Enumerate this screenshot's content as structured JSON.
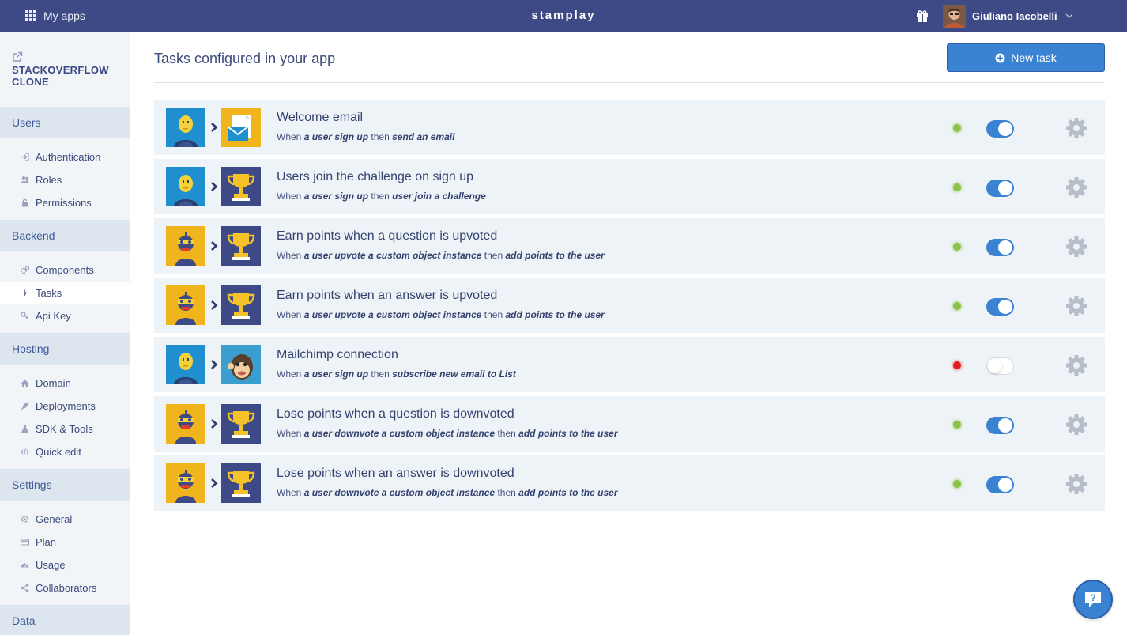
{
  "topbar": {
    "my_apps_label": "My apps",
    "brand": "stamplay",
    "user_name": "Giuliano Iacobelli"
  },
  "sidebar": {
    "app_name": "STACKOVERFLOW CLONE",
    "sections": [
      {
        "title": "Users",
        "items": [
          {
            "label": "Authentication",
            "icon": "sign-in-icon"
          },
          {
            "label": "Roles",
            "icon": "users-icon"
          },
          {
            "label": "Permissions",
            "icon": "lock-icon"
          }
        ]
      },
      {
        "title": "Backend",
        "items": [
          {
            "label": "Components",
            "icon": "cogs-icon"
          },
          {
            "label": "Tasks",
            "icon": "bolt-icon",
            "active": true
          },
          {
            "label": "Api Key",
            "icon": "key-icon"
          }
        ]
      },
      {
        "title": "Hosting",
        "items": [
          {
            "label": "Domain",
            "icon": "home-icon"
          },
          {
            "label": "Deployments",
            "icon": "rocket-icon"
          },
          {
            "label": "SDK & Tools",
            "icon": "flask-icon"
          },
          {
            "label": "Quick edit",
            "icon": "code-icon"
          }
        ]
      },
      {
        "title": "Settings",
        "items": [
          {
            "label": "General",
            "icon": "gear-icon"
          },
          {
            "label": "Plan",
            "icon": "credit-card-icon"
          },
          {
            "label": "Usage",
            "icon": "dashboard-icon"
          },
          {
            "label": "Collaborators",
            "icon": "share-icon"
          }
        ]
      },
      {
        "title": "Data",
        "items": []
      }
    ]
  },
  "main": {
    "title": "Tasks configured in your app",
    "new_task_label": "New task",
    "tasks": [
      {
        "title": "Welcome email",
        "when": "When",
        "trigger": "a user sign up",
        "then": "then",
        "action": "send an email",
        "trigger_icon": "user-icon",
        "action_icon": "email-icon",
        "enabled": true,
        "status": "active"
      },
      {
        "title": "Users join the challenge on sign up",
        "when": "When",
        "trigger": "a user sign up",
        "then": "then",
        "action": "user join a challenge",
        "trigger_icon": "user-icon",
        "action_icon": "trophy-icon",
        "enabled": true,
        "status": "active"
      },
      {
        "title": "Earn points when a question is upvoted",
        "when": "When",
        "trigger": "a user upvote a custom object instance",
        "then": "then",
        "action": "add points to the user",
        "trigger_icon": "robot-icon",
        "action_icon": "trophy-icon",
        "enabled": true,
        "status": "active"
      },
      {
        "title": "Earn points when an answer is upvoted",
        "when": "When",
        "trigger": "a user upvote a custom object instance",
        "then": "then",
        "action": "add points to the user",
        "trigger_icon": "robot-icon",
        "action_icon": "trophy-icon",
        "enabled": true,
        "status": "active"
      },
      {
        "title": "Mailchimp connection",
        "when": "When",
        "trigger": "a user sign up",
        "then": "then",
        "action": "subscribe new email to List",
        "trigger_icon": "user-icon",
        "action_icon": "mailchimp-icon",
        "enabled": false,
        "status": "error"
      },
      {
        "title": "Lose points when a question is downvoted",
        "when": "When",
        "trigger": "a user downvote a custom object instance",
        "then": "then",
        "action": "add points to the user",
        "trigger_icon": "robot-icon",
        "action_icon": "trophy-icon",
        "enabled": true,
        "status": "active"
      },
      {
        "title": "Lose points when an answer is downvoted",
        "when": "When",
        "trigger": "a user downvote a custom object instance",
        "then": "then",
        "action": "add points to the user",
        "trigger_icon": "robot-icon",
        "action_icon": "trophy-icon",
        "enabled": true,
        "status": "active"
      }
    ]
  },
  "colors": {
    "topbar": "#3e4a85",
    "accent": "#3a82d2",
    "status_ok": "#8bc34a",
    "status_error": "#e02020",
    "tile_blue": "#1f8fd0",
    "tile_yellow": "#f0b41c",
    "tile_navy": "#3e4a85"
  }
}
